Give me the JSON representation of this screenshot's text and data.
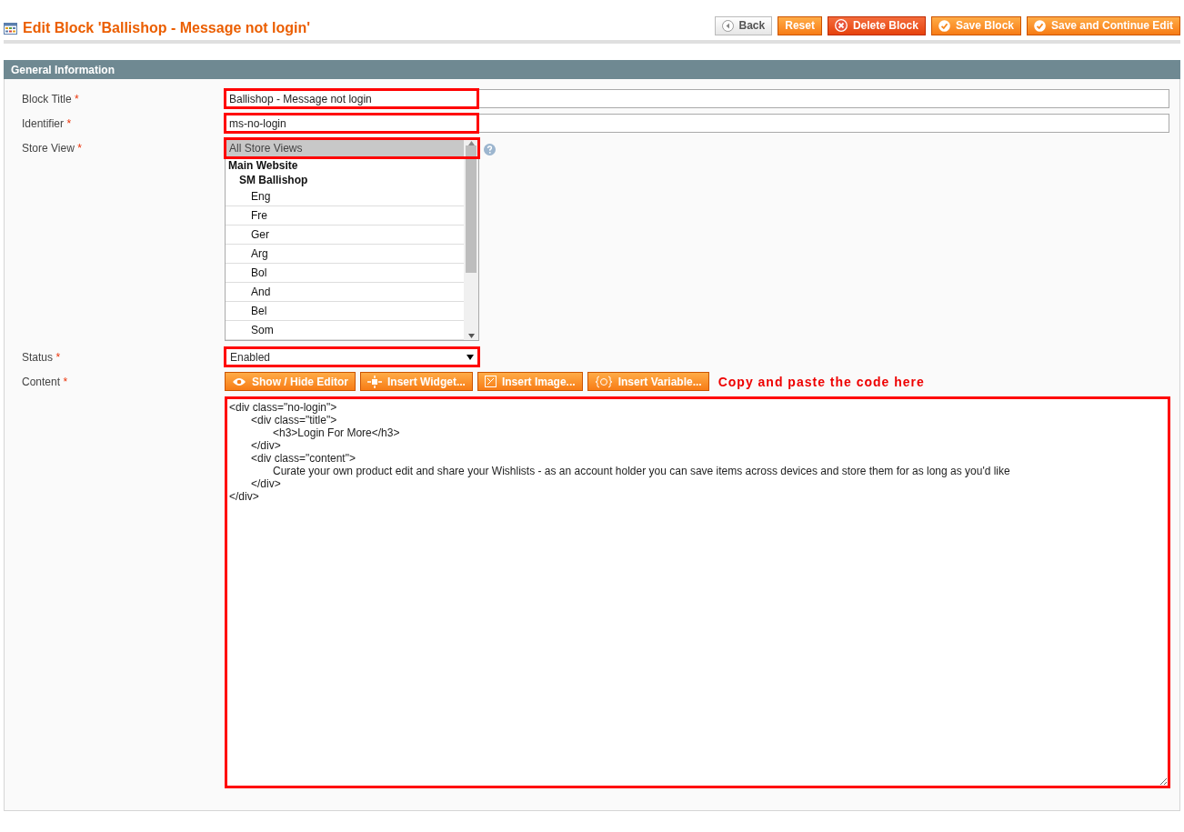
{
  "header": {
    "title": "Edit Block 'Ballishop - Message not login'"
  },
  "actions": [
    {
      "label": "Back",
      "kind": "back"
    },
    {
      "label": "Reset",
      "kind": "plain"
    },
    {
      "label": "Delete Block",
      "kind": "delete"
    },
    {
      "label": "Save Block",
      "kind": "save"
    },
    {
      "label": "Save and Continue Edit",
      "kind": "save"
    }
  ],
  "section": {
    "title": "General Information"
  },
  "fields": {
    "block_title": {
      "label": "Block Title",
      "required_mark": "*",
      "value": "Ballishop - Message not login",
      "highlighted": true
    },
    "identifier": {
      "label": "Identifier",
      "required_mark": "*",
      "value": "ms-no-login",
      "highlighted": true
    },
    "store_view": {
      "label": "Store View",
      "required_mark": "*",
      "highlighted": true,
      "options": [
        {
          "label": "All Store Views",
          "kind": "option",
          "selected": true
        },
        {
          "label": "Main Website",
          "kind": "group",
          "selected": false
        },
        {
          "label": "SM Ballishop",
          "kind": "subgroup",
          "selected": false
        },
        {
          "label": "Eng",
          "kind": "option",
          "selected": false
        },
        {
          "label": "Fre",
          "kind": "option",
          "selected": false
        },
        {
          "label": "Ger",
          "kind": "option",
          "selected": false
        },
        {
          "label": "Arg",
          "kind": "option",
          "selected": false
        },
        {
          "label": "Bol",
          "kind": "option",
          "selected": false
        },
        {
          "label": "And",
          "kind": "option",
          "selected": false
        },
        {
          "label": "Bel",
          "kind": "option",
          "selected": false
        },
        {
          "label": "Som",
          "kind": "option",
          "selected": false
        }
      ]
    },
    "status": {
      "label": "Status",
      "required_mark": "*",
      "value": "Enabled",
      "highlighted": true
    },
    "content": {
      "label": "Content",
      "required_mark": "*",
      "highlighted": true,
      "tools": [
        {
          "label": "Show / Hide Editor",
          "kind": "eye"
        },
        {
          "label": "Insert Widget...",
          "kind": "widget"
        },
        {
          "label": "Insert Image...",
          "kind": "image"
        },
        {
          "label": "Insert Variable...",
          "kind": "variable"
        }
      ],
      "note": "Copy and paste the code here",
      "value": "<div class=\"no-login\">\n\t<div class=\"title\">\n\t\t<h3>Login For More</h3>\n\t</div>\n\t<div class=\"content\">\n\t\tCurate your own product edit and share your Wishlists - as an account holder you can save items across devices and store them for as long as you'd like\n\t</div>\n</div>"
    }
  }
}
